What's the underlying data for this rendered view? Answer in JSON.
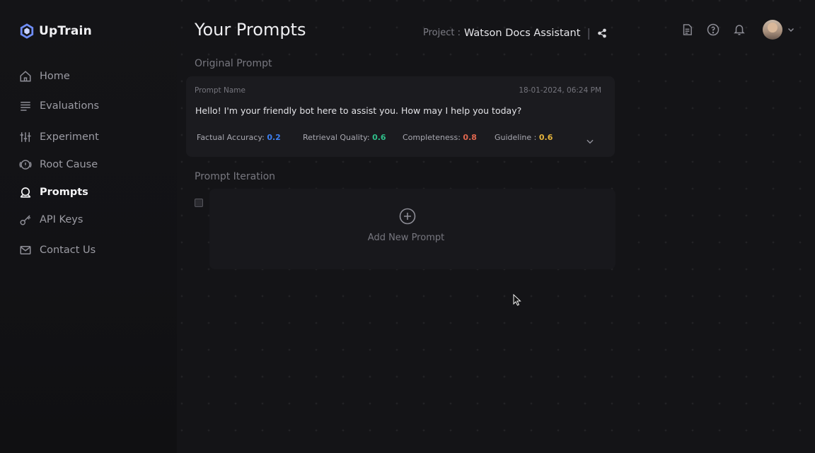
{
  "app": {
    "name": "UpTrain"
  },
  "sidebar": {
    "items": [
      {
        "label": "Home",
        "icon": "home-icon"
      },
      {
        "label": "Evaluations",
        "icon": "list-icon"
      },
      {
        "label": "Experiment",
        "icon": "sliders-icon"
      },
      {
        "label": "Root Cause",
        "icon": "alert-circle-icon"
      },
      {
        "label": "Prompts",
        "icon": "prompt-icon",
        "active": true
      },
      {
        "label": "API Keys",
        "icon": "key-icon"
      },
      {
        "label": "Contact Us",
        "icon": "mail-icon"
      }
    ]
  },
  "header": {
    "title": "Your Prompts",
    "project_label": "Project :",
    "project_name": "Watson Docs Assistant",
    "separator": "|"
  },
  "original": {
    "section_label": "Original Prompt",
    "name_label": "Prompt Name",
    "date": "18-01-2024, 06:24 PM",
    "text": "Hello! I'm your friendly bot here to assist you. How may I help you today?",
    "metrics": [
      {
        "label": "Factual Accuracy:",
        "value": "0.2",
        "color": "#3d7ff0"
      },
      {
        "label": "Retrieval Quality:",
        "value": "0.6",
        "color": "#2fbf8a"
      },
      {
        "label": "Completeness:",
        "value": "0.8",
        "color": "#e0674f"
      },
      {
        "label": "Guideline :",
        "value": "0.6",
        "color": "#e5b43b"
      }
    ]
  },
  "iteration": {
    "section_label": "Prompt Iteration",
    "add_label": "Add New Prompt"
  }
}
